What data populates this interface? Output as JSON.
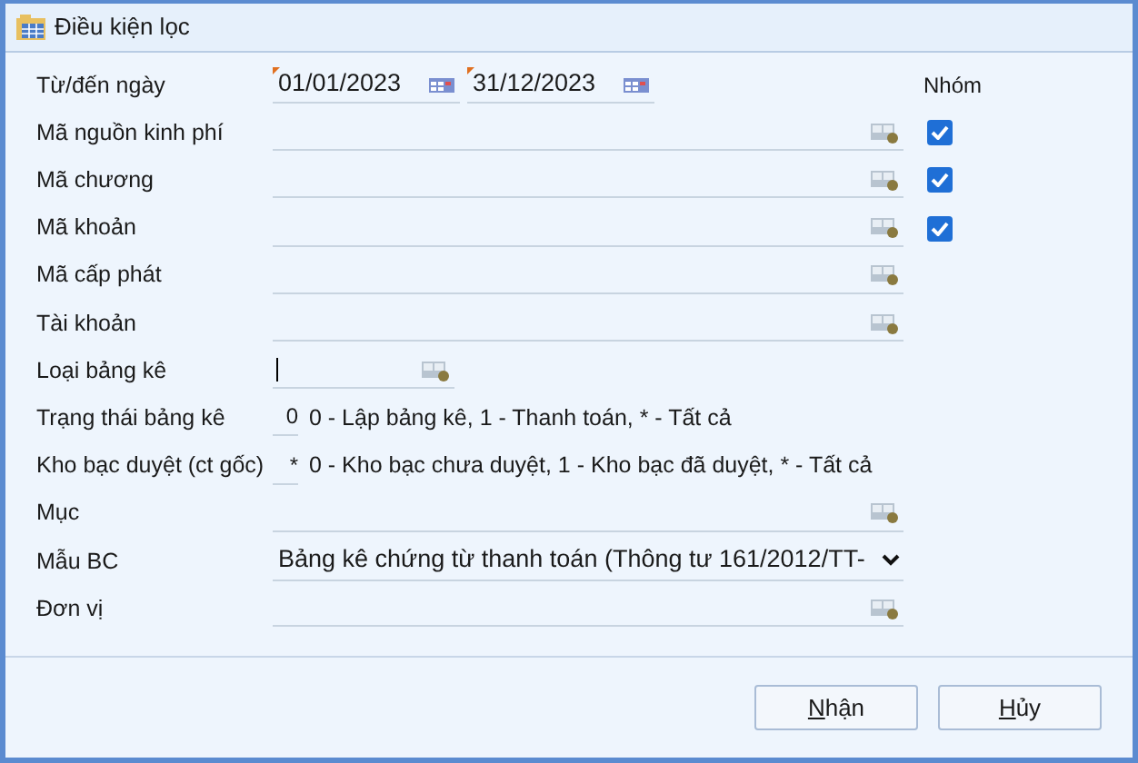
{
  "window": {
    "title": "Điều kiện lọc"
  },
  "group_header": "Nhóm",
  "rows": [
    {
      "kind": "date_range",
      "label": "Từ/đến ngày",
      "from": {
        "value": "01/01/2023",
        "required": true
      },
      "to": {
        "value": "31/12/2023",
        "required": true
      }
    },
    {
      "kind": "lookup",
      "label": "Mã nguồn kinh phí",
      "checkbox": {
        "checked": true
      }
    },
    {
      "kind": "lookup",
      "label": "Mã chương",
      "checkbox": {
        "checked": true
      }
    },
    {
      "kind": "lookup",
      "label": "Mã khoản",
      "checkbox": {
        "checked": true
      }
    },
    {
      "kind": "lookup",
      "label": "Mã cấp phát"
    },
    {
      "kind": "lookup",
      "label": "Tài khoản"
    },
    {
      "kind": "short_lookup",
      "label": "Loại bảng kê"
    },
    {
      "kind": "code",
      "label": "Trạng thái bảng kê",
      "value": "0",
      "hint": "0 - Lập bảng kê, 1 - Thanh toán, * - Tất cả"
    },
    {
      "kind": "code",
      "label": "Kho bạc duyệt (ct gốc)",
      "value": "*",
      "hint": "0 - Kho bạc chưa duyệt, 1 - Kho bạc đã duyệt, * - Tất cả"
    },
    {
      "kind": "lookup",
      "label": "Mục"
    },
    {
      "kind": "select",
      "label": "Mẫu BC",
      "value": "Bảng kê chứng từ thanh toán (Thông tư 161/2012/TT-"
    },
    {
      "kind": "lookup",
      "label": "Đơn vị"
    }
  ],
  "buttons": [
    {
      "accel": "N",
      "rest": "hận"
    },
    {
      "accel": "H",
      "rest": "ủy"
    }
  ]
}
